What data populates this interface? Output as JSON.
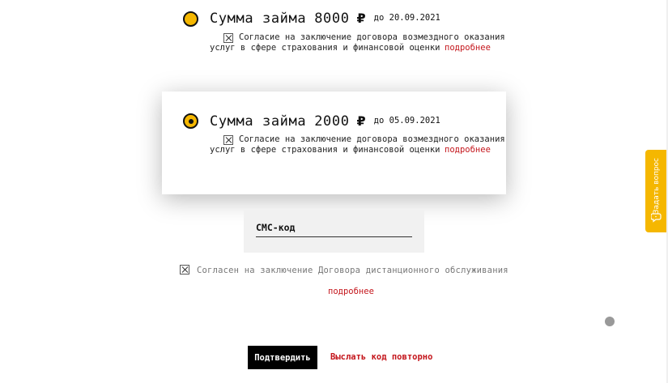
{
  "offers": [
    {
      "amount_label": "Сумма займа",
      "amount": "8000",
      "currency": "₽",
      "due": "до 20.09.2021",
      "selected": false,
      "consent_line1": "Согласие на заключение договора возмездного оказания",
      "consent_line2": "услуг в сфере страхования и финансовой оценки",
      "more_label": "подробнее"
    },
    {
      "amount_label": "Сумма займа",
      "amount": "2000",
      "currency": "₽",
      "due": "до 05.09.2021",
      "selected": true,
      "consent_line1": "Согласие на заключение договора возмездного оказания",
      "consent_line2": "услуг в сфере страхования и финансовой оценки",
      "more_label": "подробнее"
    }
  ],
  "sms": {
    "label": "СМС-код"
  },
  "agreement": {
    "text": "Согласен на заключение Договора дистанционного обслуживания",
    "more_label": "подробнее"
  },
  "actions": {
    "confirm_label": "Подтвердить",
    "resend_label": "Выслать код повторно"
  },
  "ask_tab": {
    "label": "Задать вопрос",
    "icon": "chat-question-icon"
  },
  "colors": {
    "accent": "#f5b700",
    "link": "#c4161c",
    "button": "#000000"
  }
}
